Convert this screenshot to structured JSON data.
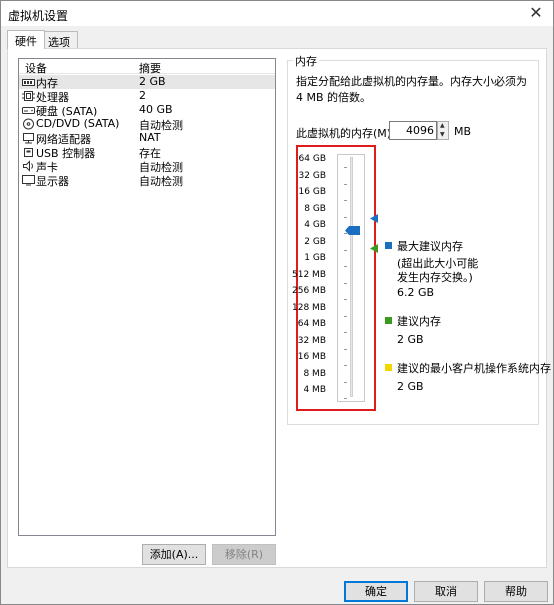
{
  "window": {
    "title": "虚拟机设置",
    "close_glyph": "✕"
  },
  "tabs": [
    {
      "label": "硬件",
      "active": true
    },
    {
      "label": "选项",
      "active": false
    }
  ],
  "device_list": {
    "columns": [
      "设备",
      "摘要"
    ],
    "rows": [
      {
        "name": "内存",
        "summary": "2 GB",
        "icon": "memory-icon",
        "selected": true
      },
      {
        "name": "处理器",
        "summary": "2",
        "icon": "processor-icon"
      },
      {
        "name": "硬盘 (SATA)",
        "summary": "40 GB",
        "icon": "hard-disk-icon"
      },
      {
        "name": "CD/DVD (SATA)",
        "summary": "自动检测",
        "icon": "cd-dvd-icon"
      },
      {
        "name": "网络适配器",
        "summary": "NAT",
        "icon": "network-adapter-icon"
      },
      {
        "name": "USB 控制器",
        "summary": "存在",
        "icon": "usb-controller-icon"
      },
      {
        "name": "声卡",
        "summary": "自动检测",
        "icon": "sound-card-icon"
      },
      {
        "name": "显示器",
        "summary": "自动检测",
        "icon": "display-icon"
      }
    ]
  },
  "buttons": {
    "add": "添加(A)...",
    "remove": "移除(R)",
    "ok": "确定",
    "cancel": "取消",
    "help": "帮助"
  },
  "memory": {
    "group_title": "内存",
    "description": "指定分配给此虚拟机的内存量。内存大小必须为 4 MB 的倍数。",
    "field_label": "此虚拟机的内存(M):",
    "value": "4096",
    "unit": "MB",
    "scale_labels": [
      "64 GB",
      "32 GB",
      "16 GB",
      "8 GB",
      "4 GB",
      "2 GB",
      "1 GB",
      "512 MB",
      "256 MB",
      "128 MB",
      "64 MB",
      "32 MB",
      "16 MB",
      "8 MB",
      "4 MB"
    ],
    "current_position_label": "4 GB",
    "max_recommended_position_label": "4 GB",
    "recommended_position_label": "2 GB",
    "legend": {
      "max_recommended": {
        "title": "最大建议内存",
        "note_line1": "(超出此大小可能",
        "note_line2": "发生内存交换。)",
        "value": "6.2 GB",
        "color": "#1a6fc0"
      },
      "recommended": {
        "title": "建议内存",
        "value": "2 GB",
        "color": "#3a9a1e"
      },
      "min_guest": {
        "title": "建议的最小客户机操作系统内存",
        "value": "2 GB",
        "color": "#f2d600"
      }
    },
    "colors": {
      "thumb": "#1a6fc0",
      "highlight_box": "#e01b1b"
    }
  }
}
